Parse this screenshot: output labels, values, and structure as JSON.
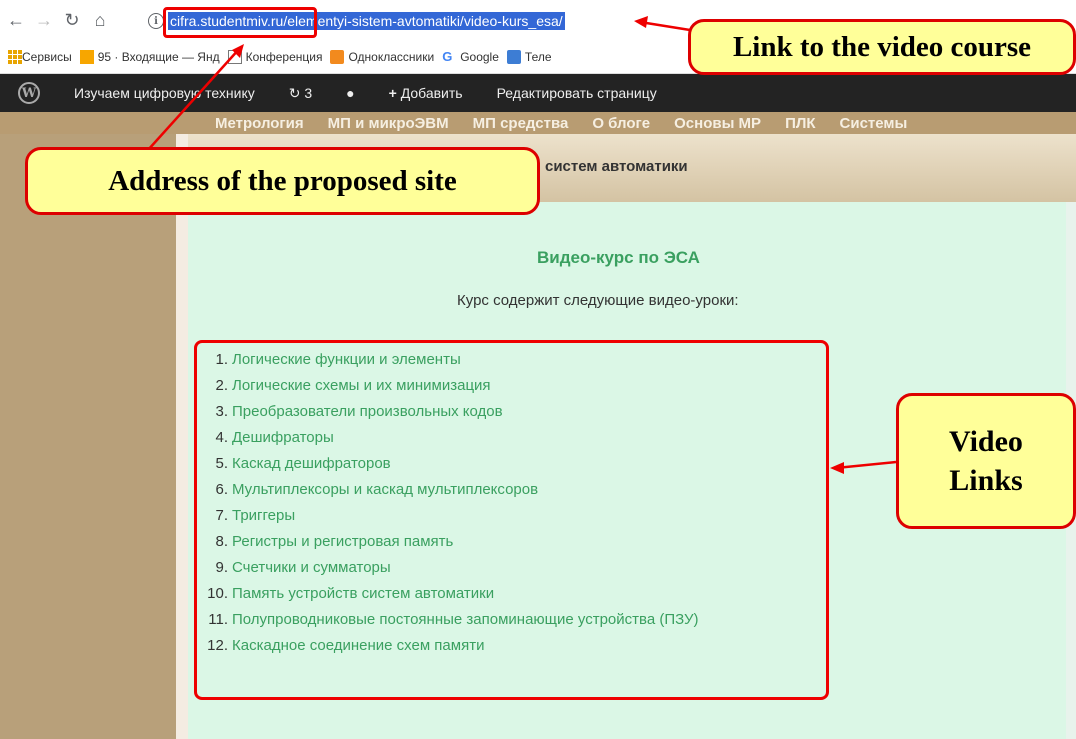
{
  "browser": {
    "url": "cifra.studentmiv.ru/elementyi-sistem-avtomatiki/video-kurs_esa/",
    "bookmarks": [
      {
        "label": "Сервисы",
        "icon": "apps-icon"
      },
      {
        "label": "95 · Входящие — Янд",
        "icon": "mail-icon"
      },
      {
        "label": "Конференция",
        "icon": "page-icon"
      },
      {
        "label": "Одноклассники",
        "icon": "ok-icon"
      },
      {
        "label": "Google",
        "icon": "google-icon"
      },
      {
        "label": "Теле",
        "icon": "tele-icon"
      }
    ]
  },
  "wp_bar": {
    "site_name": "Изучаем цифровую технику",
    "updates": "3",
    "add_label": "Добавить",
    "edit_label": "Редактировать страницу"
  },
  "site_nav": [
    "Метрология",
    "МП и микроЭВМ",
    "МП средства",
    "О блоге",
    "Основы МР",
    "ПЛК",
    "Системы"
  ],
  "page": {
    "band_title": "ы систем автоматики",
    "title": "Видео-курс по ЭСА",
    "subtitle": "Курс содержит следующие видео-уроки:",
    "lessons": [
      {
        "num": "1.",
        "label": "Логические функции и элементы"
      },
      {
        "num": "2.",
        "label": "Логические схемы и их минимизация"
      },
      {
        "num": "3.",
        "label": "Преобразователи произвольных кодов"
      },
      {
        "num": "4.",
        "label": "Дешифраторы"
      },
      {
        "num": "5.",
        "label": "Каскад дешифраторов"
      },
      {
        "num": "6.",
        "label": "Мультиплексоры и каскад мультиплексоров"
      },
      {
        "num": "7.",
        "label": "Триггеры"
      },
      {
        "num": "8.",
        "label": "Регистры и регистровая память"
      },
      {
        "num": "9.",
        "label": "Счетчики и сумматоры"
      },
      {
        "num": "10.",
        "label": "Память устройств систем автоматики"
      },
      {
        "num": "11.",
        "label": "Полупроводниковые постоянные запоминающие устройства (ПЗУ)"
      },
      {
        "num": "12.",
        "label": "Каскадное соединение схем памяти"
      }
    ]
  },
  "callouts": {
    "link": "Link to the video course",
    "address": "Address of the proposed site",
    "video_line1": "Video",
    "video_line2": "Links"
  },
  "colors": {
    "link": "#3aa060",
    "callout_bg": "#ffff99",
    "callout_border": "#dd0000"
  }
}
